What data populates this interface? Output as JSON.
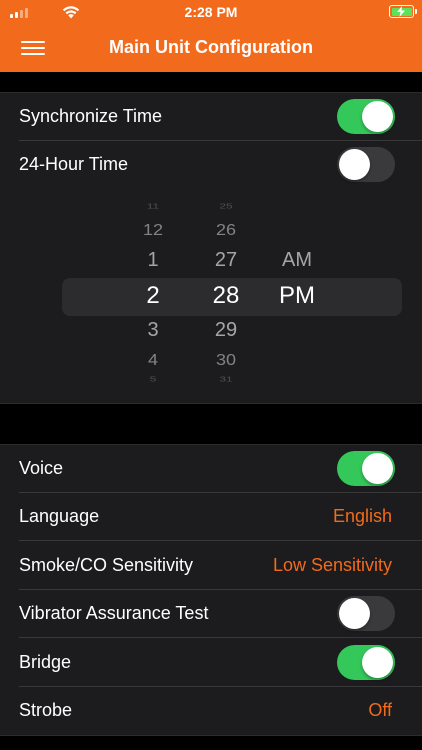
{
  "status_bar": {
    "time": "2:28 PM"
  },
  "header": {
    "title": "Main Unit Configuration",
    "background": "#f26a1b"
  },
  "time_settings": {
    "synchronize_time": {
      "label": "Synchronize Time",
      "on": true
    },
    "hour_24": {
      "label": "24-Hour Time",
      "on": false
    }
  },
  "time_picker": {
    "hours": [
      "11",
      "12",
      "1",
      "2",
      "3",
      "4",
      "5"
    ],
    "minutes": [
      "25",
      "26",
      "27",
      "28",
      "29",
      "30",
      "31"
    ],
    "ampm": [
      "AM",
      "PM"
    ],
    "selected": {
      "hour": "2",
      "minute": "28",
      "ampm": "PM"
    }
  },
  "settings": {
    "voice": {
      "label": "Voice",
      "on": true
    },
    "language": {
      "label": "Language",
      "value": "English"
    },
    "sensitivity": {
      "label": "Smoke/CO Sensitivity",
      "value": "Low Sensitivity"
    },
    "vibrator_test": {
      "label": "Vibrator Assurance Test",
      "on": false
    },
    "bridge": {
      "label": "Bridge",
      "on": true
    },
    "strobe": {
      "label": "Strobe",
      "value": "Off"
    }
  },
  "colors": {
    "accent": "#f26a1b",
    "toggle_on": "#34c759",
    "toggle_off": "#3a3a3c",
    "cell": "#1c1c1e"
  }
}
